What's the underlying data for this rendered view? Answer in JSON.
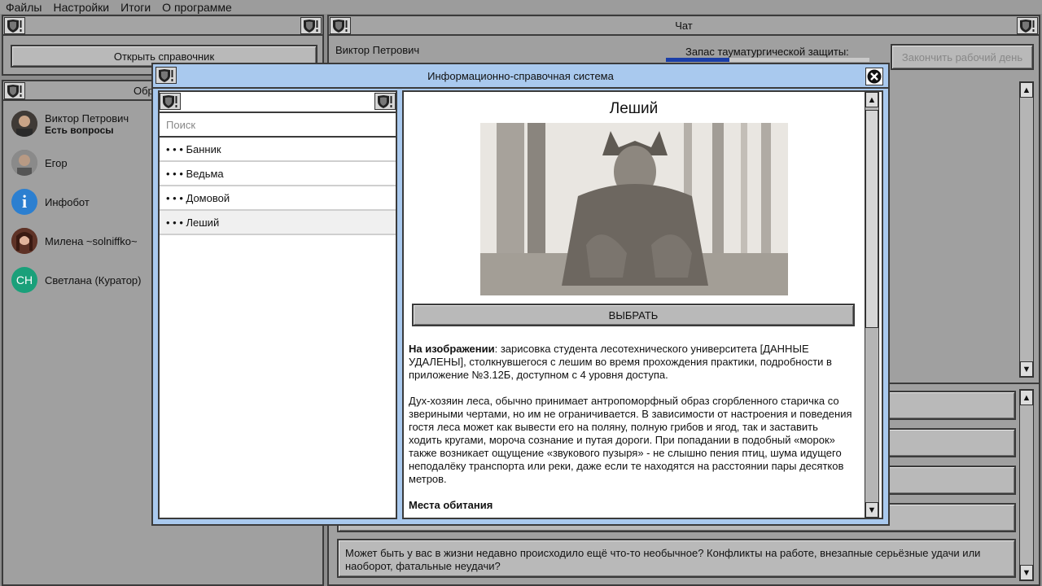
{
  "menu": [
    "Файлы",
    "Настройки",
    "Итоги",
    "О программе"
  ],
  "left_panel": {
    "open_reference_label": "Открыть справочник",
    "contacts_title_partial": "Обр"
  },
  "contacts": [
    {
      "name": "Виктор Петрович",
      "status": "Есть вопросы"
    },
    {
      "name": "Егор",
      "status": ""
    },
    {
      "name": "Инфобот",
      "status": ""
    },
    {
      "name": "Милена ~solniffko~",
      "status": ""
    },
    {
      "name": "Светлана (Куратор)",
      "status": "",
      "initials": "СН"
    }
  ],
  "chat": {
    "title": "Чат",
    "contact_name": "Виктор Петрович",
    "protection_label": "Запас тауматургической защиты:",
    "protection_level": 0.31,
    "end_day_label": "Закончить рабочий день",
    "message": "Может быть у вас в жизни недавно происходило ещё что-то необычное? Конфликты на работе, внезапные серьёзные удачи или наоборот, фатальные неудачи?"
  },
  "modal": {
    "title": "Информационно-справочная система",
    "search_placeholder": "Поиск",
    "items": [
      {
        "label": "• • • Банник",
        "selected": false
      },
      {
        "label": "• • • Ведьма",
        "selected": false
      },
      {
        "label": "• • • Домовой",
        "selected": false
      },
      {
        "label": "• • • Леший",
        "selected": true
      }
    ],
    "article": {
      "title": "Леший",
      "select_label": "ВЫБРАТЬ",
      "caption_bold": "На изображении",
      "caption_rest": ": зарисовка студента лесотехнического университета [ДАННЫЕ УДАЛЕНЫ], столкнувшегося с лешим во время прохождения практики, подробности в приложение №3.12Б, доступном с 4 уровня доступа.",
      "body": "Дух-хозяин леса, обычно принимает антропоморфный образ сгорбленного старичка со звериными чертами, но им не ограничивается. В зависимости от настроения и поведения гостя леса может как вывести его на поляну, полную грибов и ягод, так и заставить ходить кругами, мороча сознание и путая дороги. При попадании в подобный «морок» также возникает ощущение «звукового пузыря» - не слышно пения птиц, шума идущего неподалёку транспорта или реки, даже если те находятся на расстоянии пары десятков метров.",
      "section_heading": "Места обитания"
    }
  },
  "colors": {
    "modal_bg": "#a9c9ee",
    "progress": "#1a3ea8",
    "infobot": "#2c7fd0",
    "curator": "#1aa07a"
  }
}
